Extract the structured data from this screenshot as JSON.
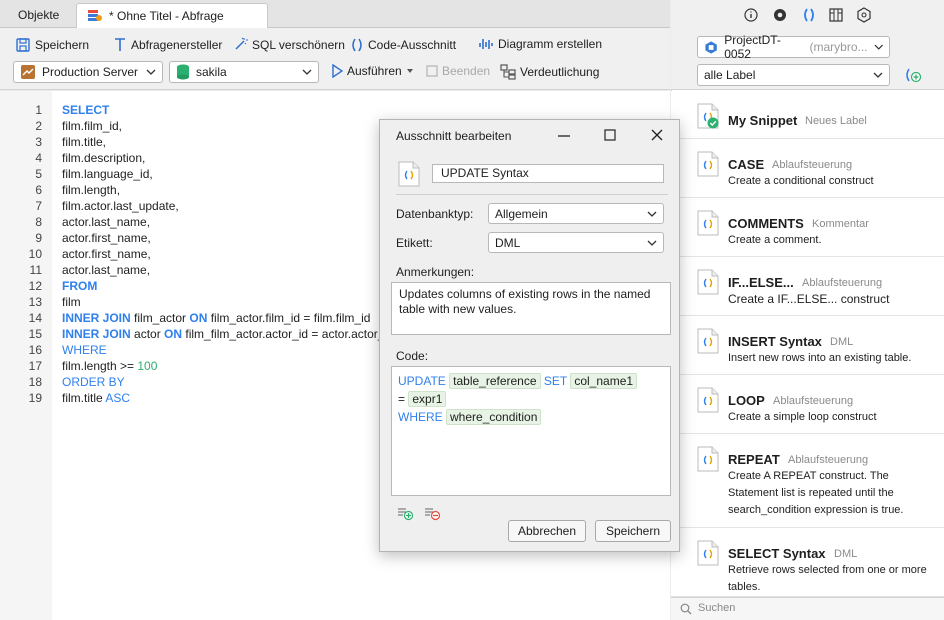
{
  "tabs": {
    "objects": "Objekte",
    "query": "* Ohne Titel - Abfrage"
  },
  "toolbar": {
    "save": "Speichern",
    "query_builder": "Abfragenersteller",
    "beautify": "SQL verschönern",
    "snippet": "Code-Ausschnitt",
    "chart": "Diagramm erstellen",
    "connection": "Production Server",
    "database": "sakila",
    "run": "Ausführen",
    "stop": "Beenden",
    "explain": "Verdeutlichung"
  },
  "editor": {
    "line_numbers": [
      "1",
      "2",
      "3",
      "4",
      "5",
      "6",
      "7",
      "8",
      "9",
      "10",
      "11",
      "12",
      "13",
      "14",
      "15",
      "16",
      "17",
      "18",
      "19"
    ],
    "lines": [
      [
        {
          "t": "SELECT",
          "c": "kw"
        }
      ],
      [
        {
          "t": "film.film_id,",
          "c": ""
        }
      ],
      [
        {
          "t": "film.title,",
          "c": ""
        }
      ],
      [
        {
          "t": "film.description,",
          "c": ""
        }
      ],
      [
        {
          "t": "film.language_id,",
          "c": ""
        }
      ],
      [
        {
          "t": "film.length,",
          "c": ""
        }
      ],
      [
        {
          "t": "film.actor.last_update,",
          "c": ""
        }
      ],
      [
        {
          "t": "actor.last_name,",
          "c": ""
        }
      ],
      [
        {
          "t": "actor.first_name,",
          "c": ""
        }
      ],
      [
        {
          "t": "actor.first_name,",
          "c": ""
        }
      ],
      [
        {
          "t": "actor.last_name,",
          "c": ""
        }
      ],
      [
        {
          "t": "FROM",
          "c": "kw"
        }
      ],
      [
        {
          "t": "film",
          "c": ""
        }
      ],
      [
        {
          "t": "INNER JOIN",
          "c": "kw"
        },
        {
          "t": " film_actor ",
          "c": ""
        },
        {
          "t": "ON",
          "c": "kw"
        },
        {
          "t": " film_actor.film_id = film.film_id",
          "c": ""
        }
      ],
      [
        {
          "t": "INNER JOIN",
          "c": "kw"
        },
        {
          "t": " actor ",
          "c": ""
        },
        {
          "t": "ON",
          "c": "kw"
        },
        {
          "t": " film_film_actor.actor_id = actor.actor_id",
          "c": ""
        }
      ],
      [
        {
          "t": "WHERE",
          "c": "kw2"
        }
      ],
      [
        {
          "t": "film.length >= ",
          "c": ""
        },
        {
          "t": "100",
          "c": "num"
        }
      ],
      [
        {
          "t": "ORDER BY",
          "c": "kw2"
        }
      ],
      [
        {
          "t": "film.title ",
          "c": ""
        },
        {
          "t": "ASC",
          "c": "kw2"
        }
      ]
    ]
  },
  "right": {
    "project": "ProjectDT-0052",
    "project_owner": "(marybro...",
    "label_filter": "alle Label",
    "search_placeholder": "Suchen",
    "snippets": [
      {
        "title": "My Snippet",
        "label": "Neues Label",
        "desc": ""
      },
      {
        "title": "CASE",
        "label": "Ablaufsteuerung",
        "desc": "Create a conditional construct"
      },
      {
        "title": "COMMENTS",
        "label": "Kommentar",
        "desc": "Create a comment."
      },
      {
        "title": "IF...ELSE...",
        "label": "Ablaufsteuerung",
        "desc": "Create a IF...ELSE... construct"
      },
      {
        "title": "INSERT Syntax",
        "label": "DML",
        "desc": "Insert new rows into an existing table."
      },
      {
        "title": "LOOP",
        "label": "Ablaufsteuerung",
        "desc": "Create a simple loop construct"
      },
      {
        "title": "REPEAT",
        "label": "Ablaufsteuerung",
        "desc": "Create A REPEAT construct. The Statement list is repeated until the search_condition expression is true."
      },
      {
        "title": "SELECT Syntax",
        "label": "DML",
        "desc": "Retrieve rows selected from one or more tables."
      }
    ]
  },
  "dialog": {
    "title": "Ausschnitt bearbeiten",
    "name_value": "UPDATE Syntax",
    "dbtype_label": "Datenbanktyp:",
    "dbtype_value": "Allgemein",
    "label_label": "Etikett:",
    "label_value": "DML",
    "remarks_label": "Anmerkungen:",
    "remarks_value": "Updates columns of existing rows in the named table with new values.",
    "code_label": "Code:",
    "code": {
      "update": "UPDATE",
      "table_ref": "table_reference",
      "set": "SET",
      "col": "col_name1",
      "eq": "=",
      "expr": "expr1",
      "where": "WHERE",
      "cond": "where_condition"
    },
    "cancel": "Abbrechen",
    "save": "Speichern"
  }
}
